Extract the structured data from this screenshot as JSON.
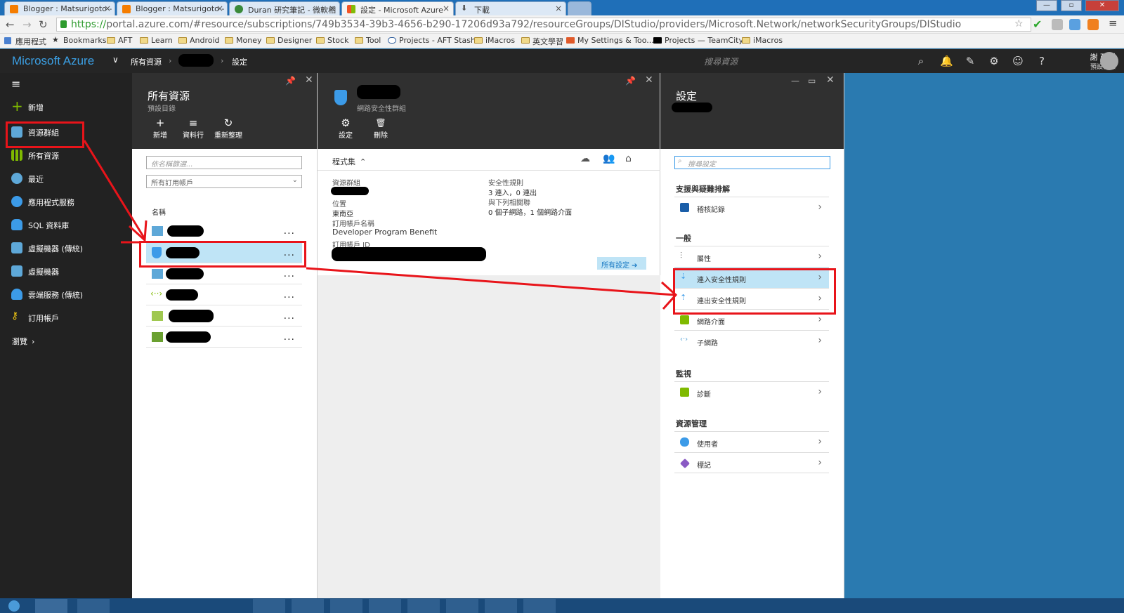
{
  "browser": {
    "tabs": [
      {
        "label": "Blogger : Matsurigoto -",
        "color": "#f57d00"
      },
      {
        "label": "Blogger : Matsurigoto -",
        "color": "#f57d00"
      },
      {
        "label": "Duran 研究筆記 - 微軟相",
        "color": "#3a8a3a"
      },
      {
        "label": "設定 - Microsoft Azure",
        "color": "#f35325"
      },
      {
        "label": "下載",
        "color": "#666666"
      }
    ],
    "url_secure": "https://",
    "url": "portal.azure.com/#resource/subscriptions/749b3534-39b3-4656-b290-17206d93a792/resourceGroups/DIStudio/providers/Microsoft.Network/networkSecurityGroups/DIStudio",
    "bookmarks": [
      "應用程式",
      "Bookmarks",
      "AFT",
      "Learn",
      "Android",
      "Money",
      "Designer",
      "Stock",
      "Tool",
      "Projects - AFT Stash",
      "iMacros",
      "英文學習",
      "My Settings & Too...",
      "Projects — TeamCity",
      "iMacros"
    ]
  },
  "azure": {
    "brand": "Microsoft Azure",
    "breadcrumb": [
      "所有資源",
      "設定"
    ],
    "search_placeholder": "搜尋資源",
    "user_name": "謝 政廷",
    "user_dir": "預設目錄"
  },
  "leftnav": [
    {
      "label": "新增",
      "icon": "plus-icon",
      "color": "#7fba00"
    },
    {
      "label": "資源群組",
      "icon": "resource-group-icon",
      "color": "#5ea8d8"
    },
    {
      "label": "所有資源",
      "icon": "grid-icon",
      "color": "#7fba00"
    },
    {
      "label": "最近",
      "icon": "clock-icon",
      "color": "#5ea8d8"
    },
    {
      "label": "應用程式服務",
      "icon": "globe-icon",
      "color": "#3c9be8"
    },
    {
      "label": "SQL 資料庫",
      "icon": "database-icon",
      "color": "#3c9be8"
    },
    {
      "label": "虛擬機器 (傳統)",
      "icon": "monitor-icon",
      "color": "#5ea8d8"
    },
    {
      "label": "虛擬機器",
      "icon": "monitor-icon",
      "color": "#5ea8d8"
    },
    {
      "label": "雲端服務 (傳統)",
      "icon": "cloud-icon",
      "color": "#3c9be8"
    },
    {
      "label": "訂用帳戶",
      "icon": "key-icon",
      "color": "#f2c811"
    },
    {
      "label": "瀏覽",
      "icon": "chevron-right-icon",
      "color": "#ffffff"
    }
  ],
  "pane1": {
    "title": "所有資源",
    "subtitle": "預設目錄",
    "tools": [
      {
        "label": "新增",
        "icon": "+"
      },
      {
        "label": "資料行",
        "icon": "≡"
      },
      {
        "label": "重新整理",
        "icon": "↻"
      }
    ],
    "filter_placeholder": "依名稱篩選...",
    "subscription_select": "所有訂用帳戶",
    "col_name": "名稱",
    "rows": [
      {
        "icon": "vm-icon",
        "color": "#5ea8d8"
      },
      {
        "icon": "shield-icon",
        "color": "#3c9be8"
      },
      {
        "icon": "storage-icon",
        "color": "#5ea8d8"
      },
      {
        "icon": "vnet-icon",
        "color": "#7fba00"
      },
      {
        "icon": "nic-icon",
        "color": "#a0c850"
      },
      {
        "icon": "ip-icon",
        "color": "#6aa030"
      }
    ],
    "more": "..."
  },
  "pane2": {
    "subtitle": "網路安全性群組",
    "tools": [
      {
        "label": "設定",
        "icon": "⚙"
      },
      {
        "label": "刪除",
        "icon": "🗑"
      }
    ],
    "essentials": "程式集",
    "left": [
      {
        "k": "資源群組",
        "v": ""
      },
      {
        "k": "位置",
        "v": "東南亞"
      },
      {
        "k": "訂用帳戶名稱",
        "v": "Developer Program Benefit"
      },
      {
        "k": "訂用帳戶 ID",
        "v": ""
      }
    ],
    "right": [
      {
        "k": "安全性規則",
        "v": "3 連入，0 連出"
      },
      {
        "k": "與下列相關聯",
        "v": "0 個子網路，1 個網路介面"
      }
    ],
    "all_settings": "所有設定 ➔"
  },
  "pane3": {
    "title": "設定",
    "search_placeholder": "搜尋設定",
    "sections": [
      {
        "heading": "支援與疑難排解",
        "items": [
          {
            "label": "稽核記錄",
            "icon": "log-icon",
            "color": "#1a5ea8"
          }
        ]
      },
      {
        "heading": "一般",
        "items": [
          {
            "label": "屬性",
            "icon": "sliders-icon",
            "color": "#666666"
          },
          {
            "label": "連入安全性規則",
            "icon": "inbound-rule-icon",
            "color": "#3c9be8",
            "highlight": true
          },
          {
            "label": "連出安全性規則",
            "icon": "outbound-rule-icon",
            "color": "#3c9be8"
          },
          {
            "label": "網路介面",
            "icon": "nic-icon",
            "color": "#7fba00"
          },
          {
            "label": "子網路",
            "icon": "subnet-icon",
            "color": "#5ea8d8"
          }
        ]
      },
      {
        "heading": "監視",
        "items": [
          {
            "label": "診斷",
            "icon": "diagnostics-icon",
            "color": "#7fba00"
          }
        ]
      },
      {
        "heading": "資源管理",
        "items": [
          {
            "label": "使用者",
            "icon": "users-icon",
            "color": "#3c9be8"
          },
          {
            "label": "標記",
            "icon": "tag-icon",
            "color": "#8a5ac4"
          }
        ]
      }
    ]
  }
}
